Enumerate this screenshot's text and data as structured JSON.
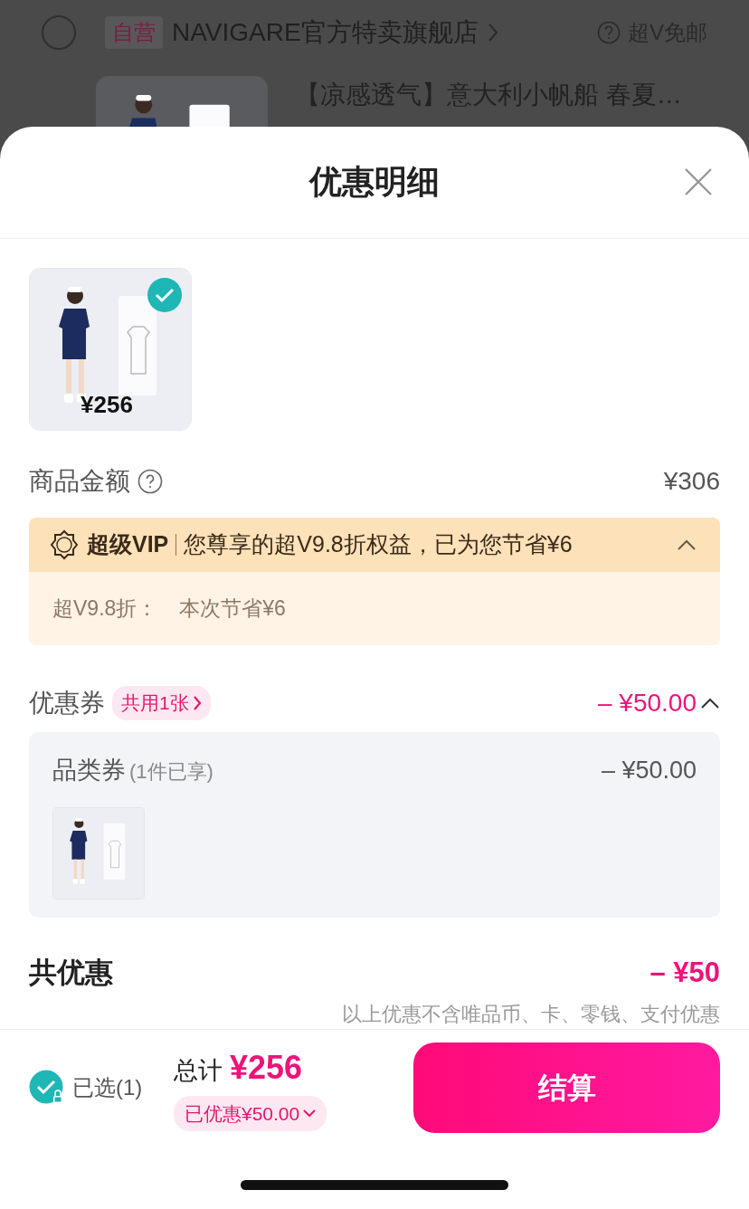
{
  "background": {
    "store_selected": false,
    "store_badge": "自营",
    "store_name": "NAVIGARE官方特卖旗舰店",
    "shipping": "超V免邮",
    "product_title": "【凉感透气】意大利小帆船 春夏…"
  },
  "sheet": {
    "title": "优惠明细"
  },
  "items": [
    {
      "kind": "picture",
      "price": "¥256",
      "checked": true
    }
  ],
  "goods_amount": {
    "label": "商品金额",
    "value": "¥306"
  },
  "vip": {
    "brand": "超级VIP",
    "summary": "您尊享的超V9.8折权益，已为您节省¥6",
    "expanded": true,
    "detail_label": "超V9.8折：",
    "detail_value": "本次节省¥6"
  },
  "coupons": {
    "label": "优惠券",
    "badge": "共用1张",
    "value": "– ¥50.00",
    "expanded": true,
    "entries": [
      {
        "name": "品类券",
        "note": "(1件已享)",
        "value": "– ¥50.00"
      }
    ]
  },
  "total_discount": {
    "label": "共优惠",
    "value": "– ¥50",
    "note": "以上优惠不含唯品币、卡、零钱、支付优惠"
  },
  "footer": {
    "all_selected": true,
    "selected_label": "已选(1)",
    "total_label": "总计",
    "total": "¥256",
    "saved": "已优惠¥50.00",
    "saved_expanded": false,
    "checkout": "结算"
  }
}
